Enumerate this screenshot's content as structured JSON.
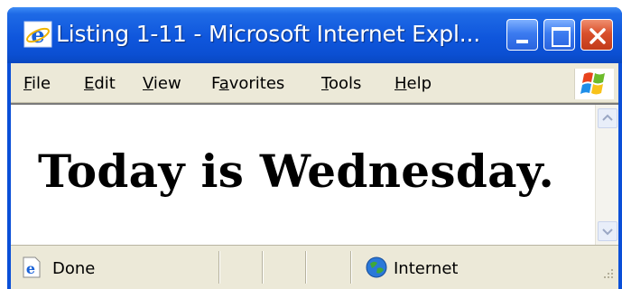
{
  "window": {
    "title": "Listing 1-11 - Microsoft Internet Expl...",
    "accent_color": "#0a4fd8"
  },
  "menu": {
    "items": [
      {
        "prefix": "",
        "key": "F",
        "rest": "ile"
      },
      {
        "prefix": "",
        "key": "E",
        "rest": "dit"
      },
      {
        "prefix": "",
        "key": "V",
        "rest": "iew"
      },
      {
        "prefix": "F",
        "key": "a",
        "rest": "vorites"
      },
      {
        "prefix": "",
        "key": "T",
        "rest": "ools"
      },
      {
        "prefix": "",
        "key": "H",
        "rest": "elp"
      }
    ]
  },
  "page": {
    "heading": "Today is Wednesday."
  },
  "status": {
    "text": "Done",
    "zone": "Internet"
  },
  "icons": {
    "title": "ie-icon",
    "logo": "windows-logo-icon",
    "status_doc": "ie-page-icon",
    "zone": "globe-icon"
  }
}
